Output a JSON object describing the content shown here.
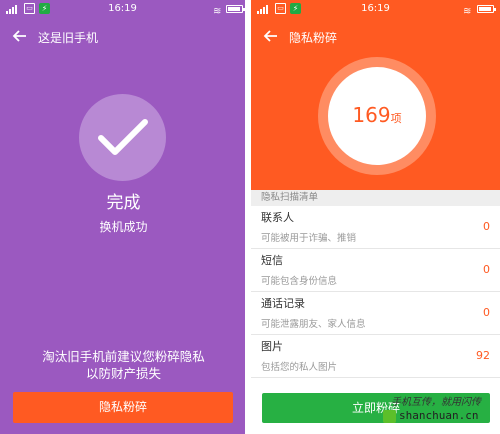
{
  "left": {
    "status_time": "16:19",
    "title": "这是旧手机",
    "done": "完成",
    "success": "换机成功",
    "suggestion_line1": "淘汰旧手机前建议您粉碎隐私",
    "suggestion_line2": "以防财产损失",
    "button_label": "隐私粉碎",
    "colors": {
      "background": "#9b59c0",
      "button": "#ff5a22"
    }
  },
  "right": {
    "status_time": "16:19",
    "title": "隐私粉碎",
    "count_value": "169",
    "count_unit": "项",
    "section_title": "隐私扫描清单",
    "items": [
      {
        "name": "联系人",
        "desc": "可能被用于诈骗、推销",
        "value": "0"
      },
      {
        "name": "短信",
        "desc": "可能包含身份信息",
        "value": "0"
      },
      {
        "name": "通话记录",
        "desc": "可能泄露朋友、家人信息",
        "value": "0"
      },
      {
        "name": "图片",
        "desc": "包括您的私人图片",
        "value": "92"
      }
    ],
    "button_label": "立即粉碎",
    "colors": {
      "header": "#ff5a22",
      "button": "#27b043"
    }
  },
  "watermark": {
    "line1": "手机互传，就用闪传",
    "line2": "shanchuan.cn"
  }
}
